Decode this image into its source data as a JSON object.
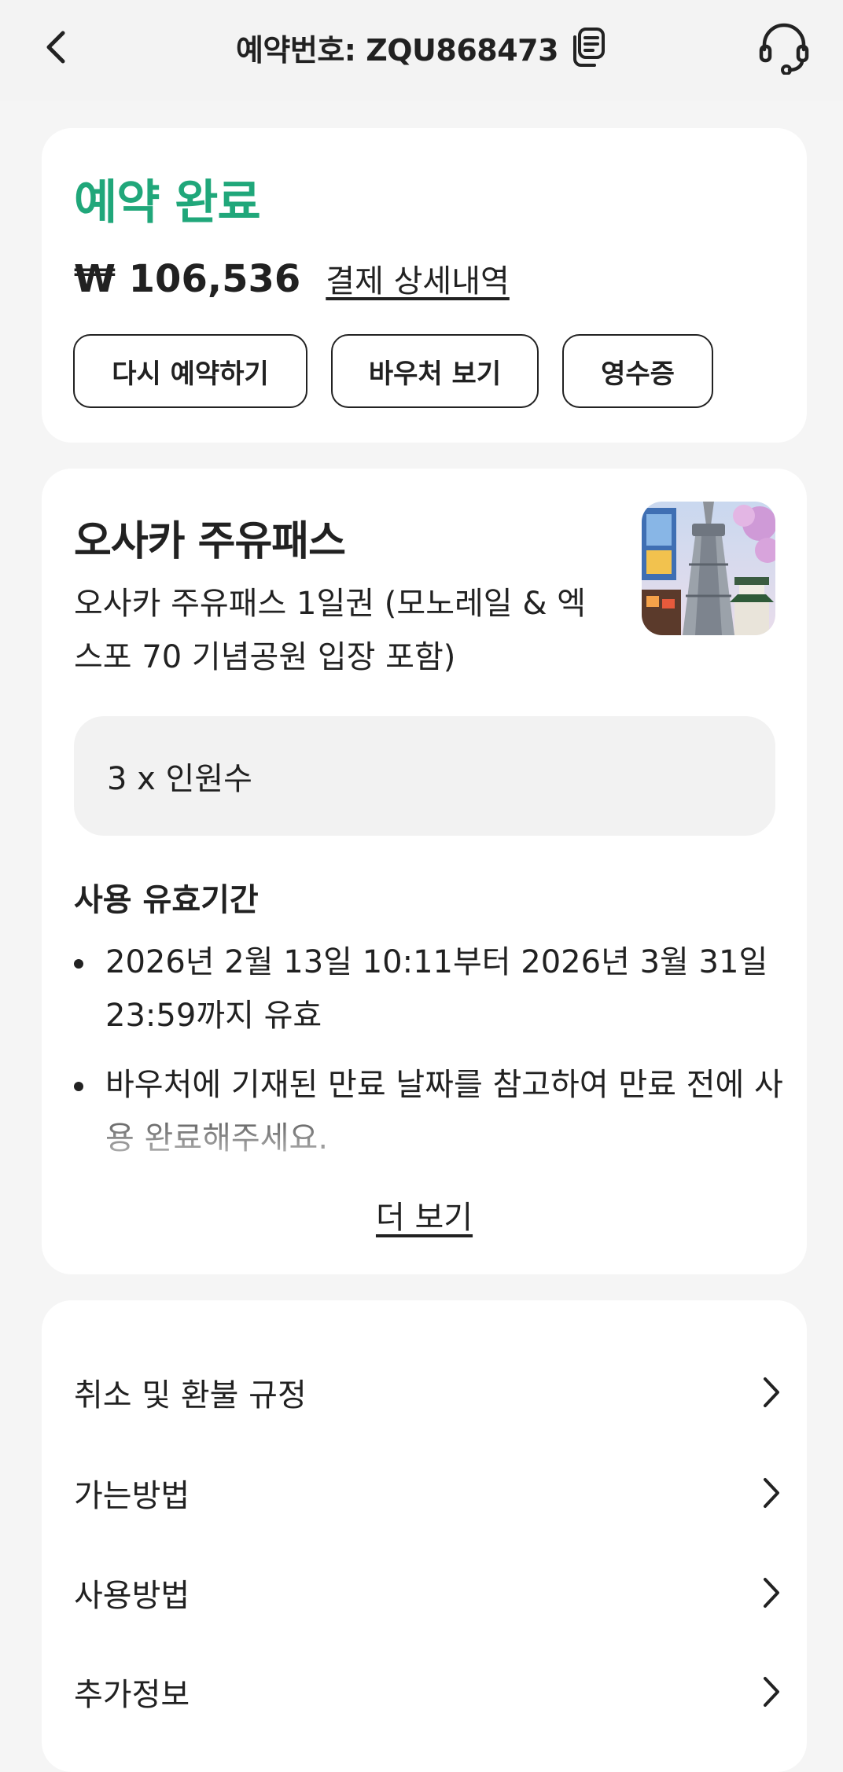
{
  "header": {
    "title": "예약번호: ZQU868473"
  },
  "booking": {
    "status": "예약 완료",
    "price": "₩ 106,536",
    "payment_detail_link": "결제 상세내역",
    "buttons": {
      "rebook": "다시 예약하기",
      "voucher": "바우처 보기",
      "receipt": "영수증"
    }
  },
  "product": {
    "title": "오사카 주유패스",
    "description": "오사카 주유패스 1일권 (모노레일 & 엑스포 70 기념공원 입장 포함)",
    "quantity": "3 x 인원수",
    "validity_title": "사용 유효기간",
    "validity_items": [
      "2026년 2월 13일 10:11부터 2026년 3월 31일 23:59까지 유효",
      "바우처에 기재된 만료 날짜를 참고하여 만료 전에 사용 완료해주세요."
    ],
    "more_link": "더 보기"
  },
  "menu": {
    "items": [
      {
        "label": "취소 및 환불 규정"
      },
      {
        "label": "가는방법"
      },
      {
        "label": "사용방법"
      },
      {
        "label": "추가정보"
      }
    ]
  },
  "colors": {
    "accent": "#20a77a",
    "background": "#f5f5f5",
    "card": "#ffffff"
  },
  "icons": [
    "back-arrow-icon",
    "copy-icon",
    "headset-icon",
    "chevron-right-icon"
  ]
}
